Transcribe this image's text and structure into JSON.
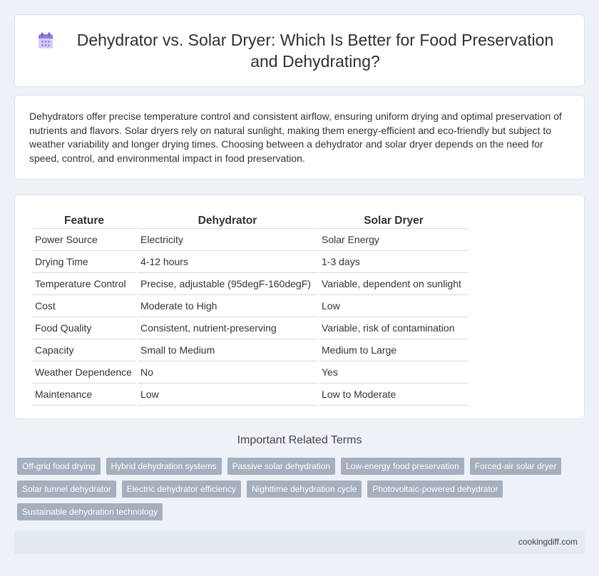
{
  "header": {
    "title": "Dehydrator vs. Solar Dryer: Which Is Better for Food Preservation and Dehydrating?",
    "icon": "calendar-icon"
  },
  "intro": {
    "text": "Dehydrators offer precise temperature control and consistent airflow, ensuring uniform drying and optimal preservation of nutrients and flavors. Solar dryers rely on natural sunlight, making them energy-efficient and eco-friendly but subject to weather variability and longer drying times. Choosing between a dehydrator and solar dryer depends on the need for speed, control, and environmental impact in food preservation."
  },
  "table": {
    "headers": [
      "Feature",
      "Dehydrator",
      "Solar Dryer"
    ],
    "rows": [
      [
        "Power Source",
        "Electricity",
        "Solar Energy"
      ],
      [
        "Drying Time",
        "4-12 hours",
        "1-3 days"
      ],
      [
        "Temperature Control",
        "Precise, adjustable (95degF-160degF)",
        "Variable, dependent on sunlight"
      ],
      [
        "Cost",
        "Moderate to High",
        "Low"
      ],
      [
        "Food Quality",
        "Consistent, nutrient-preserving",
        "Variable, risk of contamination"
      ],
      [
        "Capacity",
        "Small to Medium",
        "Medium to Large"
      ],
      [
        "Weather Dependence",
        "No",
        "Yes"
      ],
      [
        "Maintenance",
        "Low",
        "Low to Moderate"
      ]
    ]
  },
  "related": {
    "title": "Important Related Terms",
    "tags": [
      "Off-grid food drying",
      "Hybrid dehydration systems",
      "Passive solar dehydration",
      "Low-energy food preservation",
      "Forced-air solar dryer",
      "Solar tunnel dehydrator",
      "Electric dehydrator efficiency",
      "Nighttime dehydration cycle",
      "Photovoltaic-powered dehydrator",
      "Sustainable dehydration technology"
    ]
  },
  "footer": {
    "site": "cookingdiff.com"
  },
  "colors": {
    "background": "#eef2f8",
    "tag": "#a6afbd",
    "footer": "#e4eaf3"
  }
}
